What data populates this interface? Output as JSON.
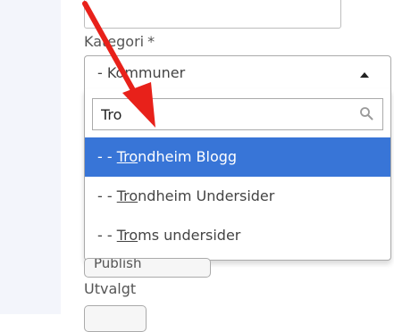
{
  "form": {
    "category_label": "Kategori",
    "category_required_mark": "*",
    "selected_category": "- Kommuner",
    "featured_label": "Utvalgt",
    "status_value": "Publish"
  },
  "dropdown": {
    "search_value": "Tro",
    "options": [
      {
        "prefix": "- - ",
        "match": "Tro",
        "rest": "ndheim Blogg",
        "highlighted": true
      },
      {
        "prefix": "- - ",
        "match": "Tro",
        "rest": "ndheim Undersider",
        "highlighted": false
      },
      {
        "prefix": "- - ",
        "match": "Tro",
        "rest": "ms undersider",
        "highlighted": false
      }
    ]
  },
  "colors": {
    "highlight": "#3875d7",
    "annotation_arrow": "#e8211a",
    "sidebar": "#f3f5fb"
  },
  "icons": {
    "search": "search-icon",
    "select_arrow": "chevron-up-icon",
    "annotation": "arrow-annotation-icon"
  }
}
